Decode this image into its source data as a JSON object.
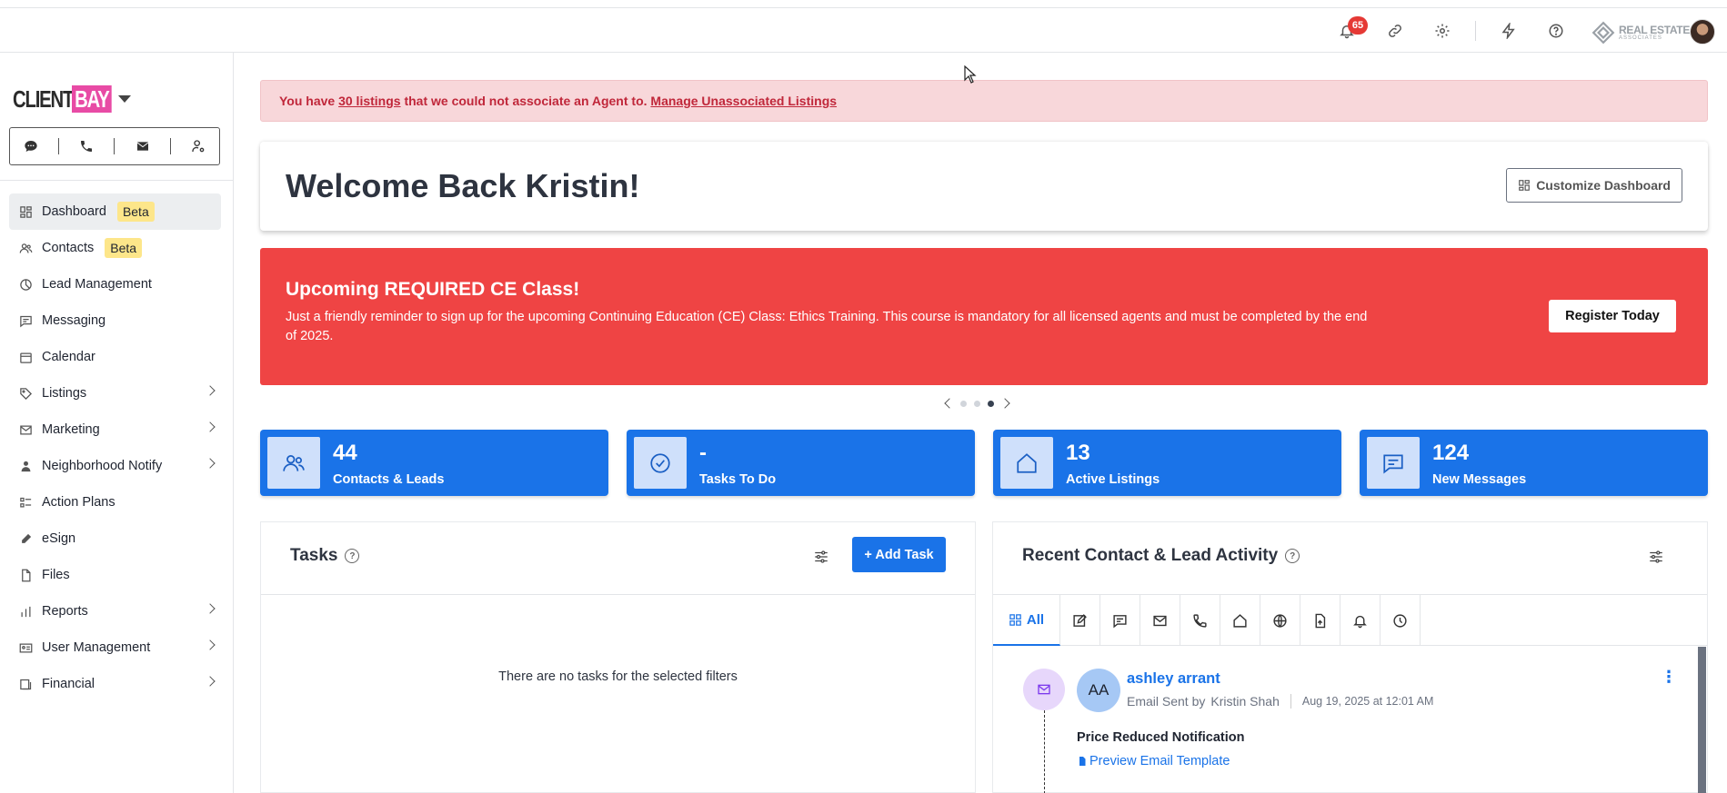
{
  "topbar": {
    "notification_count": "65",
    "logo_text": "REAL ESTATE",
    "logo_sub": "ASSOCIATES"
  },
  "brand": {
    "client": "CLIENT",
    "bay": "BAY"
  },
  "sidebar": {
    "items": [
      {
        "label": "Dashboard",
        "badge": "Beta"
      },
      {
        "label": "Contacts",
        "badge": "Beta"
      },
      {
        "label": "Lead Management"
      },
      {
        "label": "Messaging"
      },
      {
        "label": "Calendar"
      },
      {
        "label": "Listings"
      },
      {
        "label": "Marketing"
      },
      {
        "label": "Neighborhood Notify"
      },
      {
        "label": "Action Plans"
      },
      {
        "label": "eSign"
      },
      {
        "label": "Files"
      },
      {
        "label": "Reports"
      },
      {
        "label": "User Management"
      },
      {
        "label": "Financial"
      }
    ]
  },
  "alert": {
    "prefix": "You have ",
    "link_count": "30 listings",
    "middle": " that we could not associate an Agent to. ",
    "link_manage": "Manage Unassociated Listings"
  },
  "welcome": {
    "title": "Welcome Back Kristin!",
    "customize_label": "Customize Dashboard"
  },
  "banner": {
    "title": "Upcoming REQUIRED CE Class!",
    "body": "Just a friendly reminder to sign up for the upcoming Continuing Education (CE) Class: Ethics Training. This course is mandatory for all licensed agents and must be completed by the end of 2025.",
    "button": "Register Today"
  },
  "stats": [
    {
      "value": "44",
      "label": "Contacts & Leads"
    },
    {
      "value": "-",
      "label": "Tasks To Do"
    },
    {
      "value": "13",
      "label": "Active Listings"
    },
    {
      "value": "124",
      "label": "New Messages"
    }
  ],
  "tasks": {
    "title": "Tasks",
    "add_label": "+ Add Task",
    "empty": "There are no tasks for the selected filters"
  },
  "activity": {
    "title": "Recent Contact & Lead Activity",
    "tab_all": "All",
    "entry": {
      "initials": "AA",
      "name": "ashley arrant",
      "action": "Email Sent by",
      "agent": "Kristin Shah",
      "date": "Aug 19, 2025 at 12:01 AM",
      "subject": "Price Reduced Notification",
      "link": "Preview Email Template"
    }
  },
  "colors": {
    "primary": "#1a73e8",
    "banner": "#ef4444",
    "alert_bg": "#f8d7da",
    "beta_badge": "#fde68a",
    "brand_pink": "#e84ba5"
  }
}
